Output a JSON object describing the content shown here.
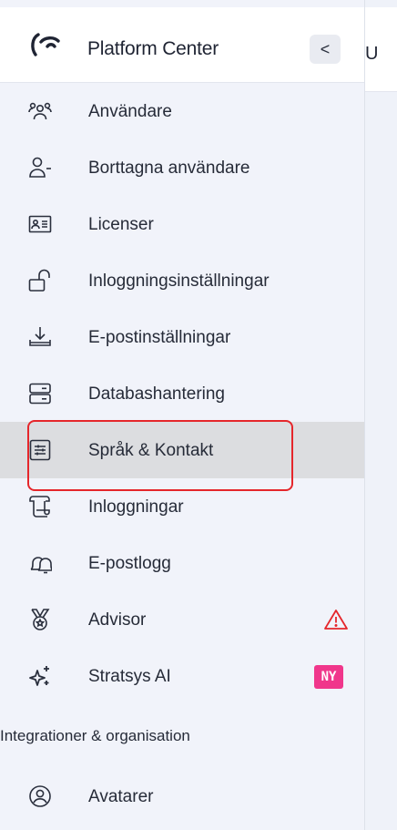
{
  "sidebar": {
    "title": "Platform Center",
    "collapse_label": "<",
    "items": [
      {
        "label": "Användare",
        "icon": "users-icon"
      },
      {
        "label": "Borttagna användare",
        "icon": "user-minus-icon"
      },
      {
        "label": "Licenser",
        "icon": "id-card-icon"
      },
      {
        "label": "Inloggningsinställningar",
        "icon": "lock-open-icon"
      },
      {
        "label": "E-postinställningar",
        "icon": "download-tray-icon"
      },
      {
        "label": "Databashantering",
        "icon": "server-icon"
      },
      {
        "label": "Språk & Kontakt",
        "icon": "sliders-panel-icon",
        "active": true
      },
      {
        "label": "Inloggningar",
        "icon": "scroll-icon"
      },
      {
        "label": "E-postlogg",
        "icon": "bells-icon"
      },
      {
        "label": "Advisor",
        "icon": "medal-icon",
        "badge_icon": "warning-icon"
      },
      {
        "label": "Stratsys AI",
        "icon": "sparkles-icon",
        "badge": "NY"
      },
      {
        "label": "Avatarer",
        "icon": "user-circle-icon"
      }
    ],
    "section_heading": "Integrationer & organisation"
  },
  "main": {
    "header_fragment": "U"
  },
  "colors": {
    "active_bg": "#dcdde0",
    "highlight_border": "#e5262b",
    "badge_bg": "#f0368b",
    "warning": "#e5262b"
  }
}
